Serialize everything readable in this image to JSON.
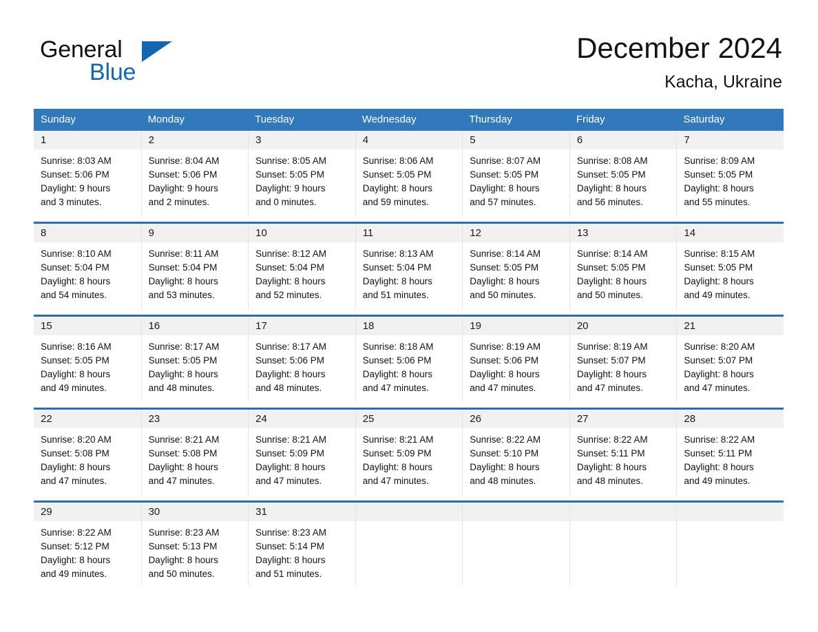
{
  "brand": {
    "name_part1": "General",
    "name_part2": "Blue",
    "triangle_color": "#1267AE",
    "logo_icon": "general-blue-logo"
  },
  "header": {
    "title": "December 2024",
    "subtitle": "Kacha, Ukraine"
  },
  "colors": {
    "header_blue": "#3279BC",
    "row_rule_blue": "#2E6DAD",
    "daynum_band": "#F1F1F1",
    "brand_blue": "#1267AE"
  },
  "weekdays": [
    "Sunday",
    "Monday",
    "Tuesday",
    "Wednesday",
    "Thursday",
    "Friday",
    "Saturday"
  ],
  "weeks": [
    [
      {
        "day": "1",
        "sunrise": "Sunrise: 8:03 AM",
        "sunset": "Sunset: 5:06 PM",
        "daylight_1": "Daylight: 9 hours",
        "daylight_2": "and 3 minutes."
      },
      {
        "day": "2",
        "sunrise": "Sunrise: 8:04 AM",
        "sunset": "Sunset: 5:06 PM",
        "daylight_1": "Daylight: 9 hours",
        "daylight_2": "and 2 minutes."
      },
      {
        "day": "3",
        "sunrise": "Sunrise: 8:05 AM",
        "sunset": "Sunset: 5:05 PM",
        "daylight_1": "Daylight: 9 hours",
        "daylight_2": "and 0 minutes."
      },
      {
        "day": "4",
        "sunrise": "Sunrise: 8:06 AM",
        "sunset": "Sunset: 5:05 PM",
        "daylight_1": "Daylight: 8 hours",
        "daylight_2": "and 59 minutes."
      },
      {
        "day": "5",
        "sunrise": "Sunrise: 8:07 AM",
        "sunset": "Sunset: 5:05 PM",
        "daylight_1": "Daylight: 8 hours",
        "daylight_2": "and 57 minutes."
      },
      {
        "day": "6",
        "sunrise": "Sunrise: 8:08 AM",
        "sunset": "Sunset: 5:05 PM",
        "daylight_1": "Daylight: 8 hours",
        "daylight_2": "and 56 minutes."
      },
      {
        "day": "7",
        "sunrise": "Sunrise: 8:09 AM",
        "sunset": "Sunset: 5:05 PM",
        "daylight_1": "Daylight: 8 hours",
        "daylight_2": "and 55 minutes."
      }
    ],
    [
      {
        "day": "8",
        "sunrise": "Sunrise: 8:10 AM",
        "sunset": "Sunset: 5:04 PM",
        "daylight_1": "Daylight: 8 hours",
        "daylight_2": "and 54 minutes."
      },
      {
        "day": "9",
        "sunrise": "Sunrise: 8:11 AM",
        "sunset": "Sunset: 5:04 PM",
        "daylight_1": "Daylight: 8 hours",
        "daylight_2": "and 53 minutes."
      },
      {
        "day": "10",
        "sunrise": "Sunrise: 8:12 AM",
        "sunset": "Sunset: 5:04 PM",
        "daylight_1": "Daylight: 8 hours",
        "daylight_2": "and 52 minutes."
      },
      {
        "day": "11",
        "sunrise": "Sunrise: 8:13 AM",
        "sunset": "Sunset: 5:04 PM",
        "daylight_1": "Daylight: 8 hours",
        "daylight_2": "and 51 minutes."
      },
      {
        "day": "12",
        "sunrise": "Sunrise: 8:14 AM",
        "sunset": "Sunset: 5:05 PM",
        "daylight_1": "Daylight: 8 hours",
        "daylight_2": "and 50 minutes."
      },
      {
        "day": "13",
        "sunrise": "Sunrise: 8:14 AM",
        "sunset": "Sunset: 5:05 PM",
        "daylight_1": "Daylight: 8 hours",
        "daylight_2": "and 50 minutes."
      },
      {
        "day": "14",
        "sunrise": "Sunrise: 8:15 AM",
        "sunset": "Sunset: 5:05 PM",
        "daylight_1": "Daylight: 8 hours",
        "daylight_2": "and 49 minutes."
      }
    ],
    [
      {
        "day": "15",
        "sunrise": "Sunrise: 8:16 AM",
        "sunset": "Sunset: 5:05 PM",
        "daylight_1": "Daylight: 8 hours",
        "daylight_2": "and 49 minutes."
      },
      {
        "day": "16",
        "sunrise": "Sunrise: 8:17 AM",
        "sunset": "Sunset: 5:05 PM",
        "daylight_1": "Daylight: 8 hours",
        "daylight_2": "and 48 minutes."
      },
      {
        "day": "17",
        "sunrise": "Sunrise: 8:17 AM",
        "sunset": "Sunset: 5:06 PM",
        "daylight_1": "Daylight: 8 hours",
        "daylight_2": "and 48 minutes."
      },
      {
        "day": "18",
        "sunrise": "Sunrise: 8:18 AM",
        "sunset": "Sunset: 5:06 PM",
        "daylight_1": "Daylight: 8 hours",
        "daylight_2": "and 47 minutes."
      },
      {
        "day": "19",
        "sunrise": "Sunrise: 8:19 AM",
        "sunset": "Sunset: 5:06 PM",
        "daylight_1": "Daylight: 8 hours",
        "daylight_2": "and 47 minutes."
      },
      {
        "day": "20",
        "sunrise": "Sunrise: 8:19 AM",
        "sunset": "Sunset: 5:07 PM",
        "daylight_1": "Daylight: 8 hours",
        "daylight_2": "and 47 minutes."
      },
      {
        "day": "21",
        "sunrise": "Sunrise: 8:20 AM",
        "sunset": "Sunset: 5:07 PM",
        "daylight_1": "Daylight: 8 hours",
        "daylight_2": "and 47 minutes."
      }
    ],
    [
      {
        "day": "22",
        "sunrise": "Sunrise: 8:20 AM",
        "sunset": "Sunset: 5:08 PM",
        "daylight_1": "Daylight: 8 hours",
        "daylight_2": "and 47 minutes."
      },
      {
        "day": "23",
        "sunrise": "Sunrise: 8:21 AM",
        "sunset": "Sunset: 5:08 PM",
        "daylight_1": "Daylight: 8 hours",
        "daylight_2": "and 47 minutes."
      },
      {
        "day": "24",
        "sunrise": "Sunrise: 8:21 AM",
        "sunset": "Sunset: 5:09 PM",
        "daylight_1": "Daylight: 8 hours",
        "daylight_2": "and 47 minutes."
      },
      {
        "day": "25",
        "sunrise": "Sunrise: 8:21 AM",
        "sunset": "Sunset: 5:09 PM",
        "daylight_1": "Daylight: 8 hours",
        "daylight_2": "and 47 minutes."
      },
      {
        "day": "26",
        "sunrise": "Sunrise: 8:22 AM",
        "sunset": "Sunset: 5:10 PM",
        "daylight_1": "Daylight: 8 hours",
        "daylight_2": "and 48 minutes."
      },
      {
        "day": "27",
        "sunrise": "Sunrise: 8:22 AM",
        "sunset": "Sunset: 5:11 PM",
        "daylight_1": "Daylight: 8 hours",
        "daylight_2": "and 48 minutes."
      },
      {
        "day": "28",
        "sunrise": "Sunrise: 8:22 AM",
        "sunset": "Sunset: 5:11 PM",
        "daylight_1": "Daylight: 8 hours",
        "daylight_2": "and 49 minutes."
      }
    ],
    [
      {
        "day": "29",
        "sunrise": "Sunrise: 8:22 AM",
        "sunset": "Sunset: 5:12 PM",
        "daylight_1": "Daylight: 8 hours",
        "daylight_2": "and 49 minutes."
      },
      {
        "day": "30",
        "sunrise": "Sunrise: 8:23 AM",
        "sunset": "Sunset: 5:13 PM",
        "daylight_1": "Daylight: 8 hours",
        "daylight_2": "and 50 minutes."
      },
      {
        "day": "31",
        "sunrise": "Sunrise: 8:23 AM",
        "sunset": "Sunset: 5:14 PM",
        "daylight_1": "Daylight: 8 hours",
        "daylight_2": "and 51 minutes."
      },
      {
        "day": "",
        "sunrise": "",
        "sunset": "",
        "daylight_1": "",
        "daylight_2": ""
      },
      {
        "day": "",
        "sunrise": "",
        "sunset": "",
        "daylight_1": "",
        "daylight_2": ""
      },
      {
        "day": "",
        "sunrise": "",
        "sunset": "",
        "daylight_1": "",
        "daylight_2": ""
      },
      {
        "day": "",
        "sunrise": "",
        "sunset": "",
        "daylight_1": "",
        "daylight_2": ""
      }
    ]
  ]
}
